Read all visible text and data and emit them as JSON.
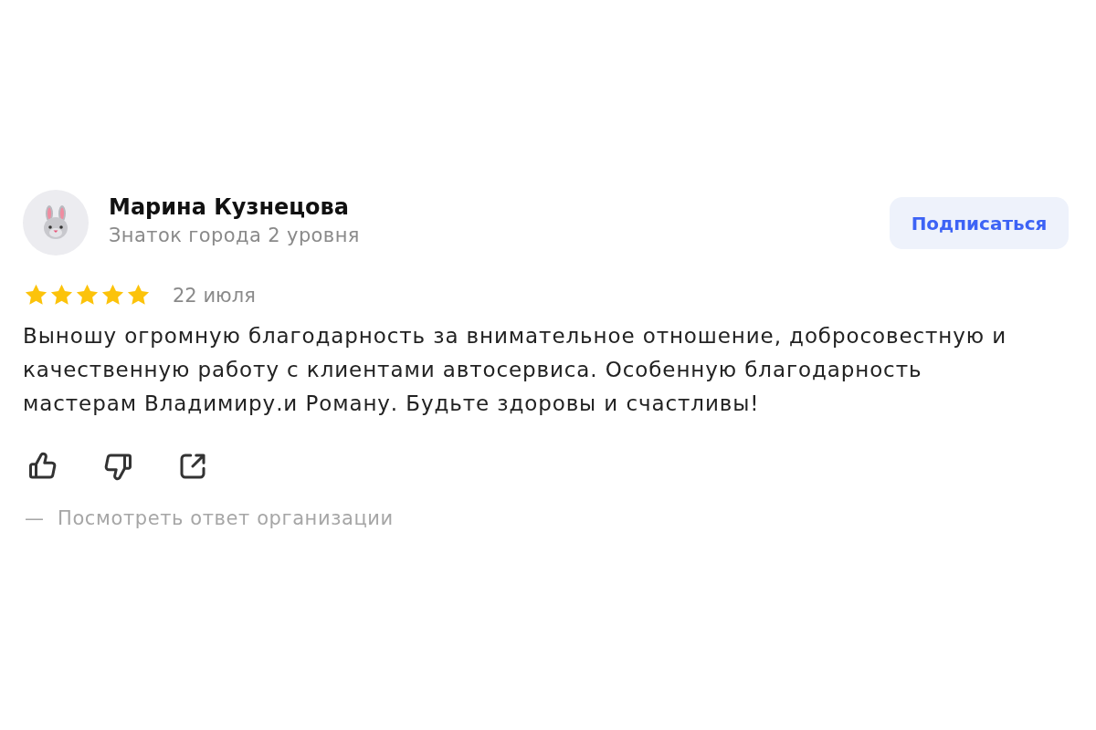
{
  "review": {
    "author": {
      "name": "Марина Кузнецова",
      "level": "Знаток города 2 уровня"
    },
    "subscribe_button": "Подписаться",
    "stars": 5,
    "date": "22 июля",
    "text": "Выношу огромную благодарность за внимательное отношение, добросовестную и качественную работу с клиентами автосервиса. Особенную благодарность мастерам Владимиру.и Роману. Будьте здоровы и счастливы!",
    "actions": [
      {
        "kind": "like"
      },
      {
        "kind": "dislike"
      },
      {
        "kind": "share"
      }
    ],
    "org_reply_link": {
      "dash": "—",
      "label": "Посмотреть ответ организации"
    }
  }
}
